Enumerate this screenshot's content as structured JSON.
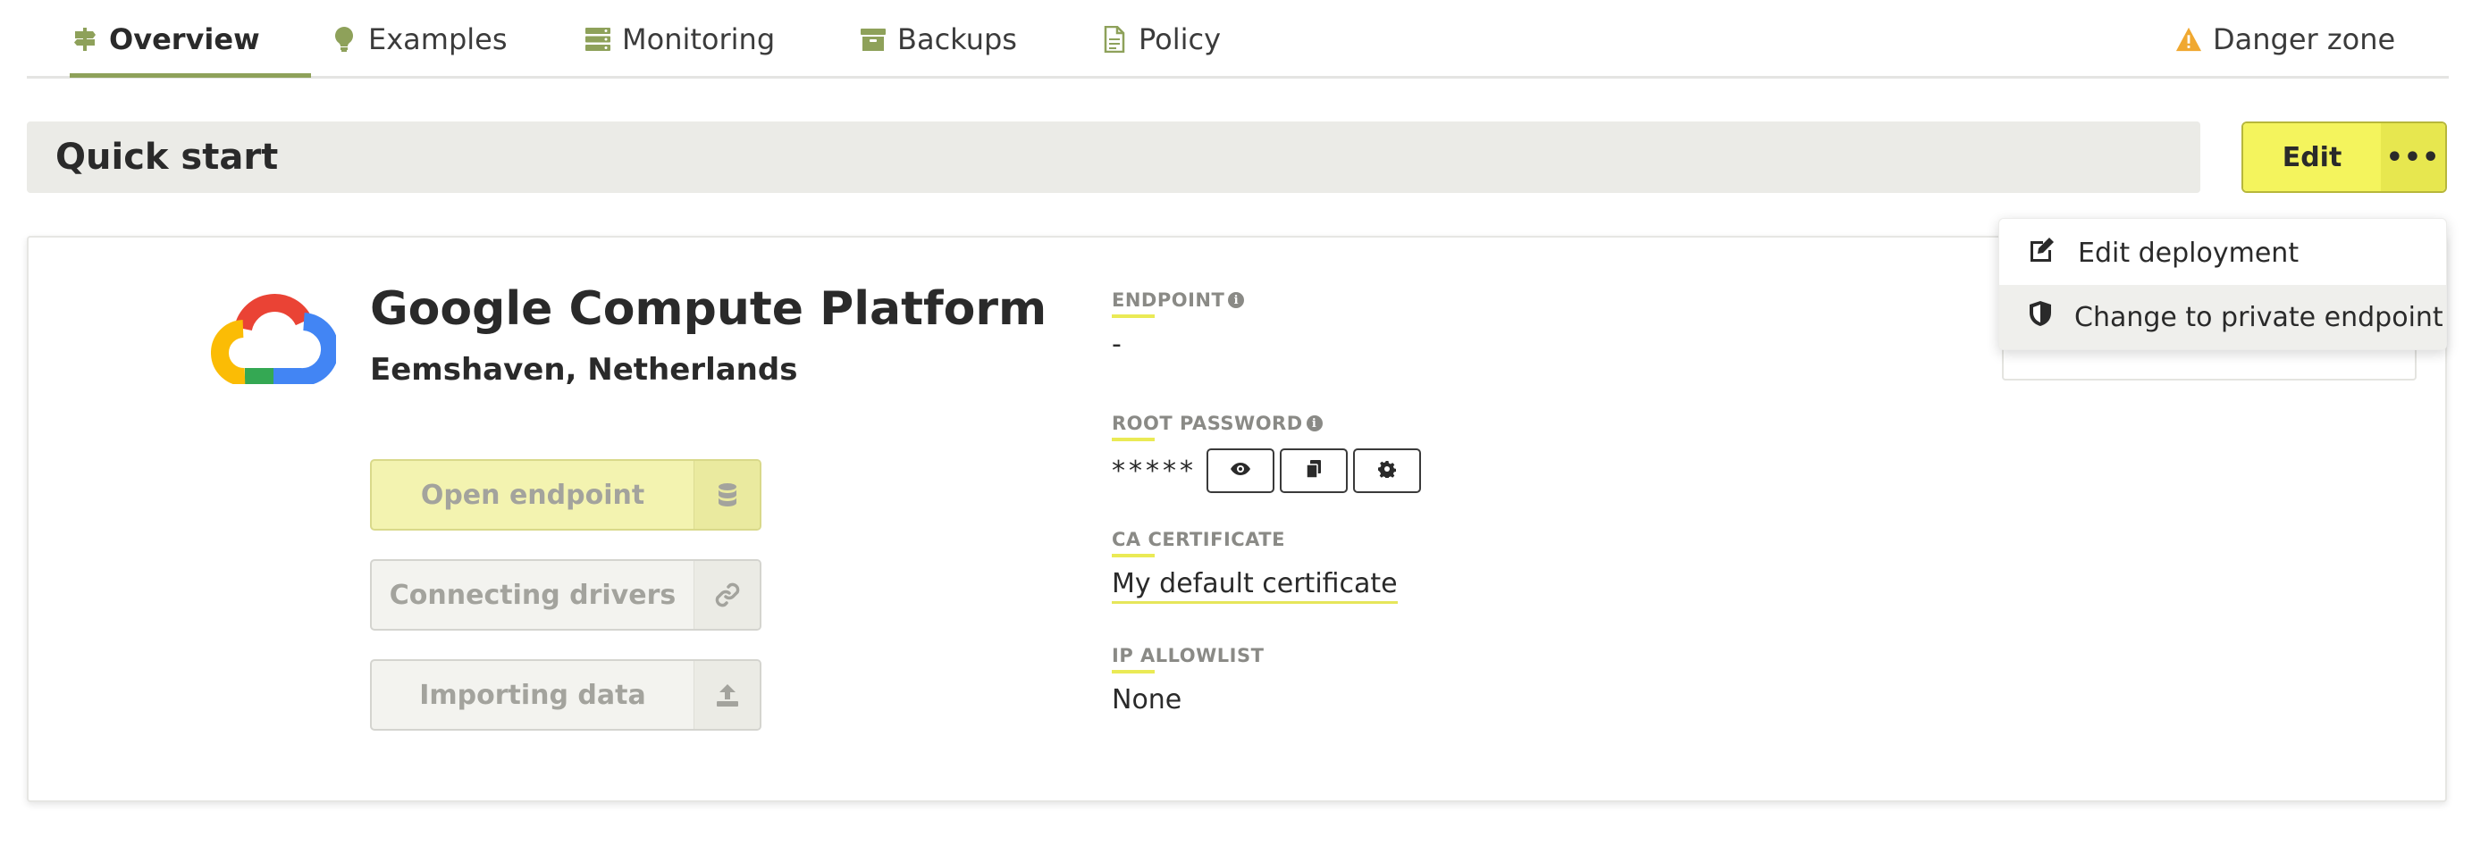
{
  "tabs": [
    {
      "label": "Overview",
      "icon": "signpost-icon"
    },
    {
      "label": "Examples",
      "icon": "lightbulb-icon"
    },
    {
      "label": "Monitoring",
      "icon": "server-icon"
    },
    {
      "label": "Backups",
      "icon": "archive-icon"
    },
    {
      "label": "Policy",
      "icon": "document-icon"
    },
    {
      "label": "Danger zone",
      "icon": "warning-icon"
    }
  ],
  "header": {
    "title": "Quick start",
    "edit_label": "Edit",
    "more_label": "•••"
  },
  "deployment": {
    "provider": "Google Compute Platform",
    "region": "Eemshaven, Netherlands",
    "logo": "google-cloud-logo"
  },
  "actions": [
    {
      "label": "Open endpoint",
      "icon": "database-icon"
    },
    {
      "label": "Connecting drivers",
      "icon": "link-icon"
    },
    {
      "label": "Importing data",
      "icon": "upload-icon"
    }
  ],
  "fields": {
    "endpoint_label": "ENDPOINT",
    "endpoint_value": "-",
    "root_password_label": "ROOT PASSWORD",
    "root_password_value": "*****",
    "ca_certificate_label": "CA CERTIFICATE",
    "ca_certificate_value": "My default certificate",
    "ip_allowlist_label": "IP ALLOWLIST",
    "ip_allowlist_value": "None"
  },
  "dropdown": {
    "items": [
      {
        "label": "Edit deployment",
        "icon": "edit-icon"
      },
      {
        "label": "Change to private endpoint",
        "icon": "shield-icon"
      }
    ]
  },
  "colors": {
    "accent_green": "#8ea15a",
    "accent_yellow": "#f4f45d",
    "warning_orange": "#f0a830"
  }
}
